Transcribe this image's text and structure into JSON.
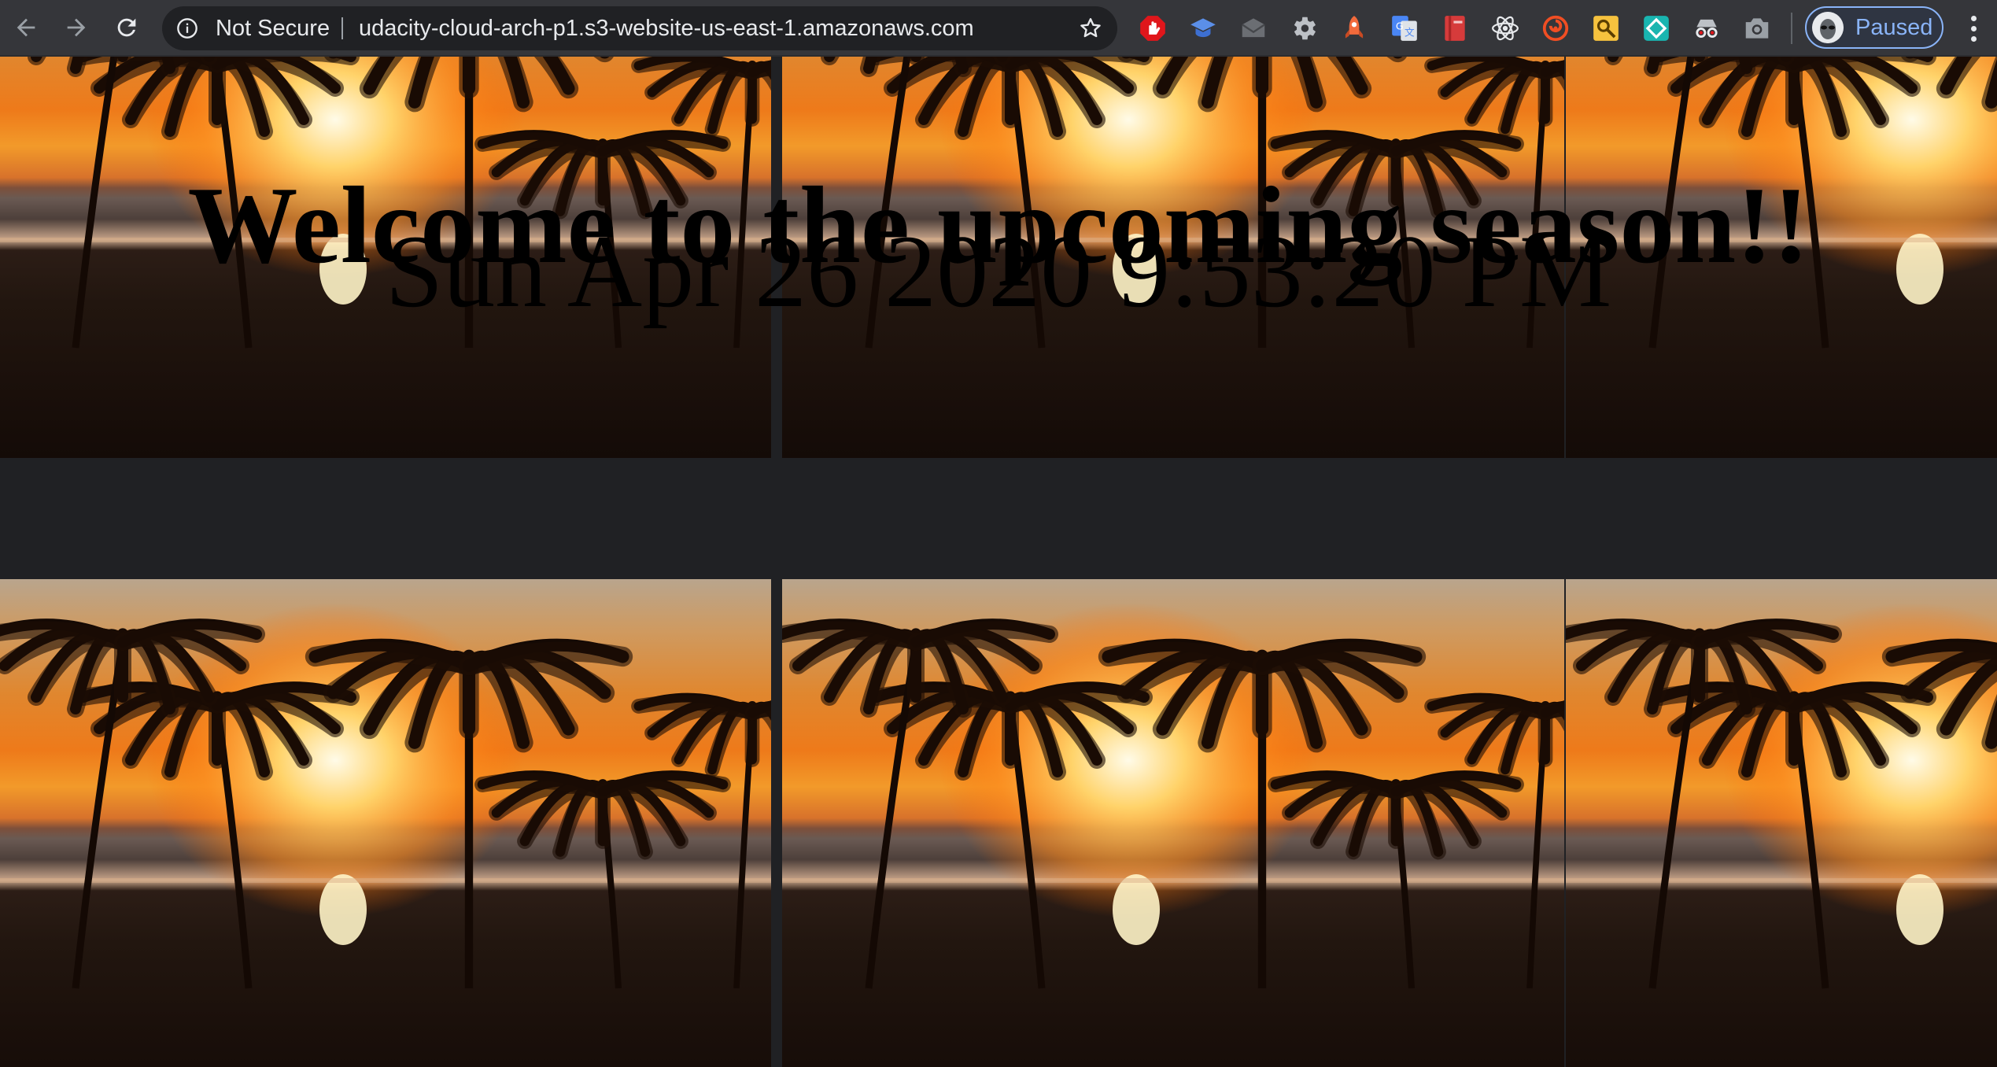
{
  "browser": {
    "security_label": "Not Secure",
    "url": "udacity-cloud-arch-p1.s3-website-us-east-1.amazonaws.com",
    "profile_status": "Paused",
    "extensions": [
      {
        "icon": "adblock-icon",
        "color": "#e0161b"
      },
      {
        "icon": "graduation-cap-icon",
        "color": "#5b8fe8"
      },
      {
        "icon": "envelope-icon",
        "color": "#6b6e73"
      },
      {
        "icon": "gear-icon",
        "color": "#bdc1c6"
      },
      {
        "icon": "rocket-icon",
        "color": "#f26a3b"
      },
      {
        "icon": "google-translate-icon",
        "color": "#4a86f5"
      },
      {
        "icon": "book-icon",
        "color": "#d63b3b"
      },
      {
        "icon": "react-atom-icon",
        "color": "#e8eaed"
      },
      {
        "icon": "swirl-icon",
        "color": "#f04e23"
      },
      {
        "icon": "image-search-icon",
        "color": "#f6c23e"
      },
      {
        "icon": "diamond-icon",
        "color": "#19b5b0"
      },
      {
        "icon": "spy-glasses-icon",
        "color": "#e8eaed"
      },
      {
        "icon": "camera-icon",
        "color": "#9aa0a6"
      }
    ]
  },
  "page": {
    "title": "Welcome to the upcoming season!!",
    "datetime": "Sun Apr 26 2020 9:53:20 PM"
  }
}
